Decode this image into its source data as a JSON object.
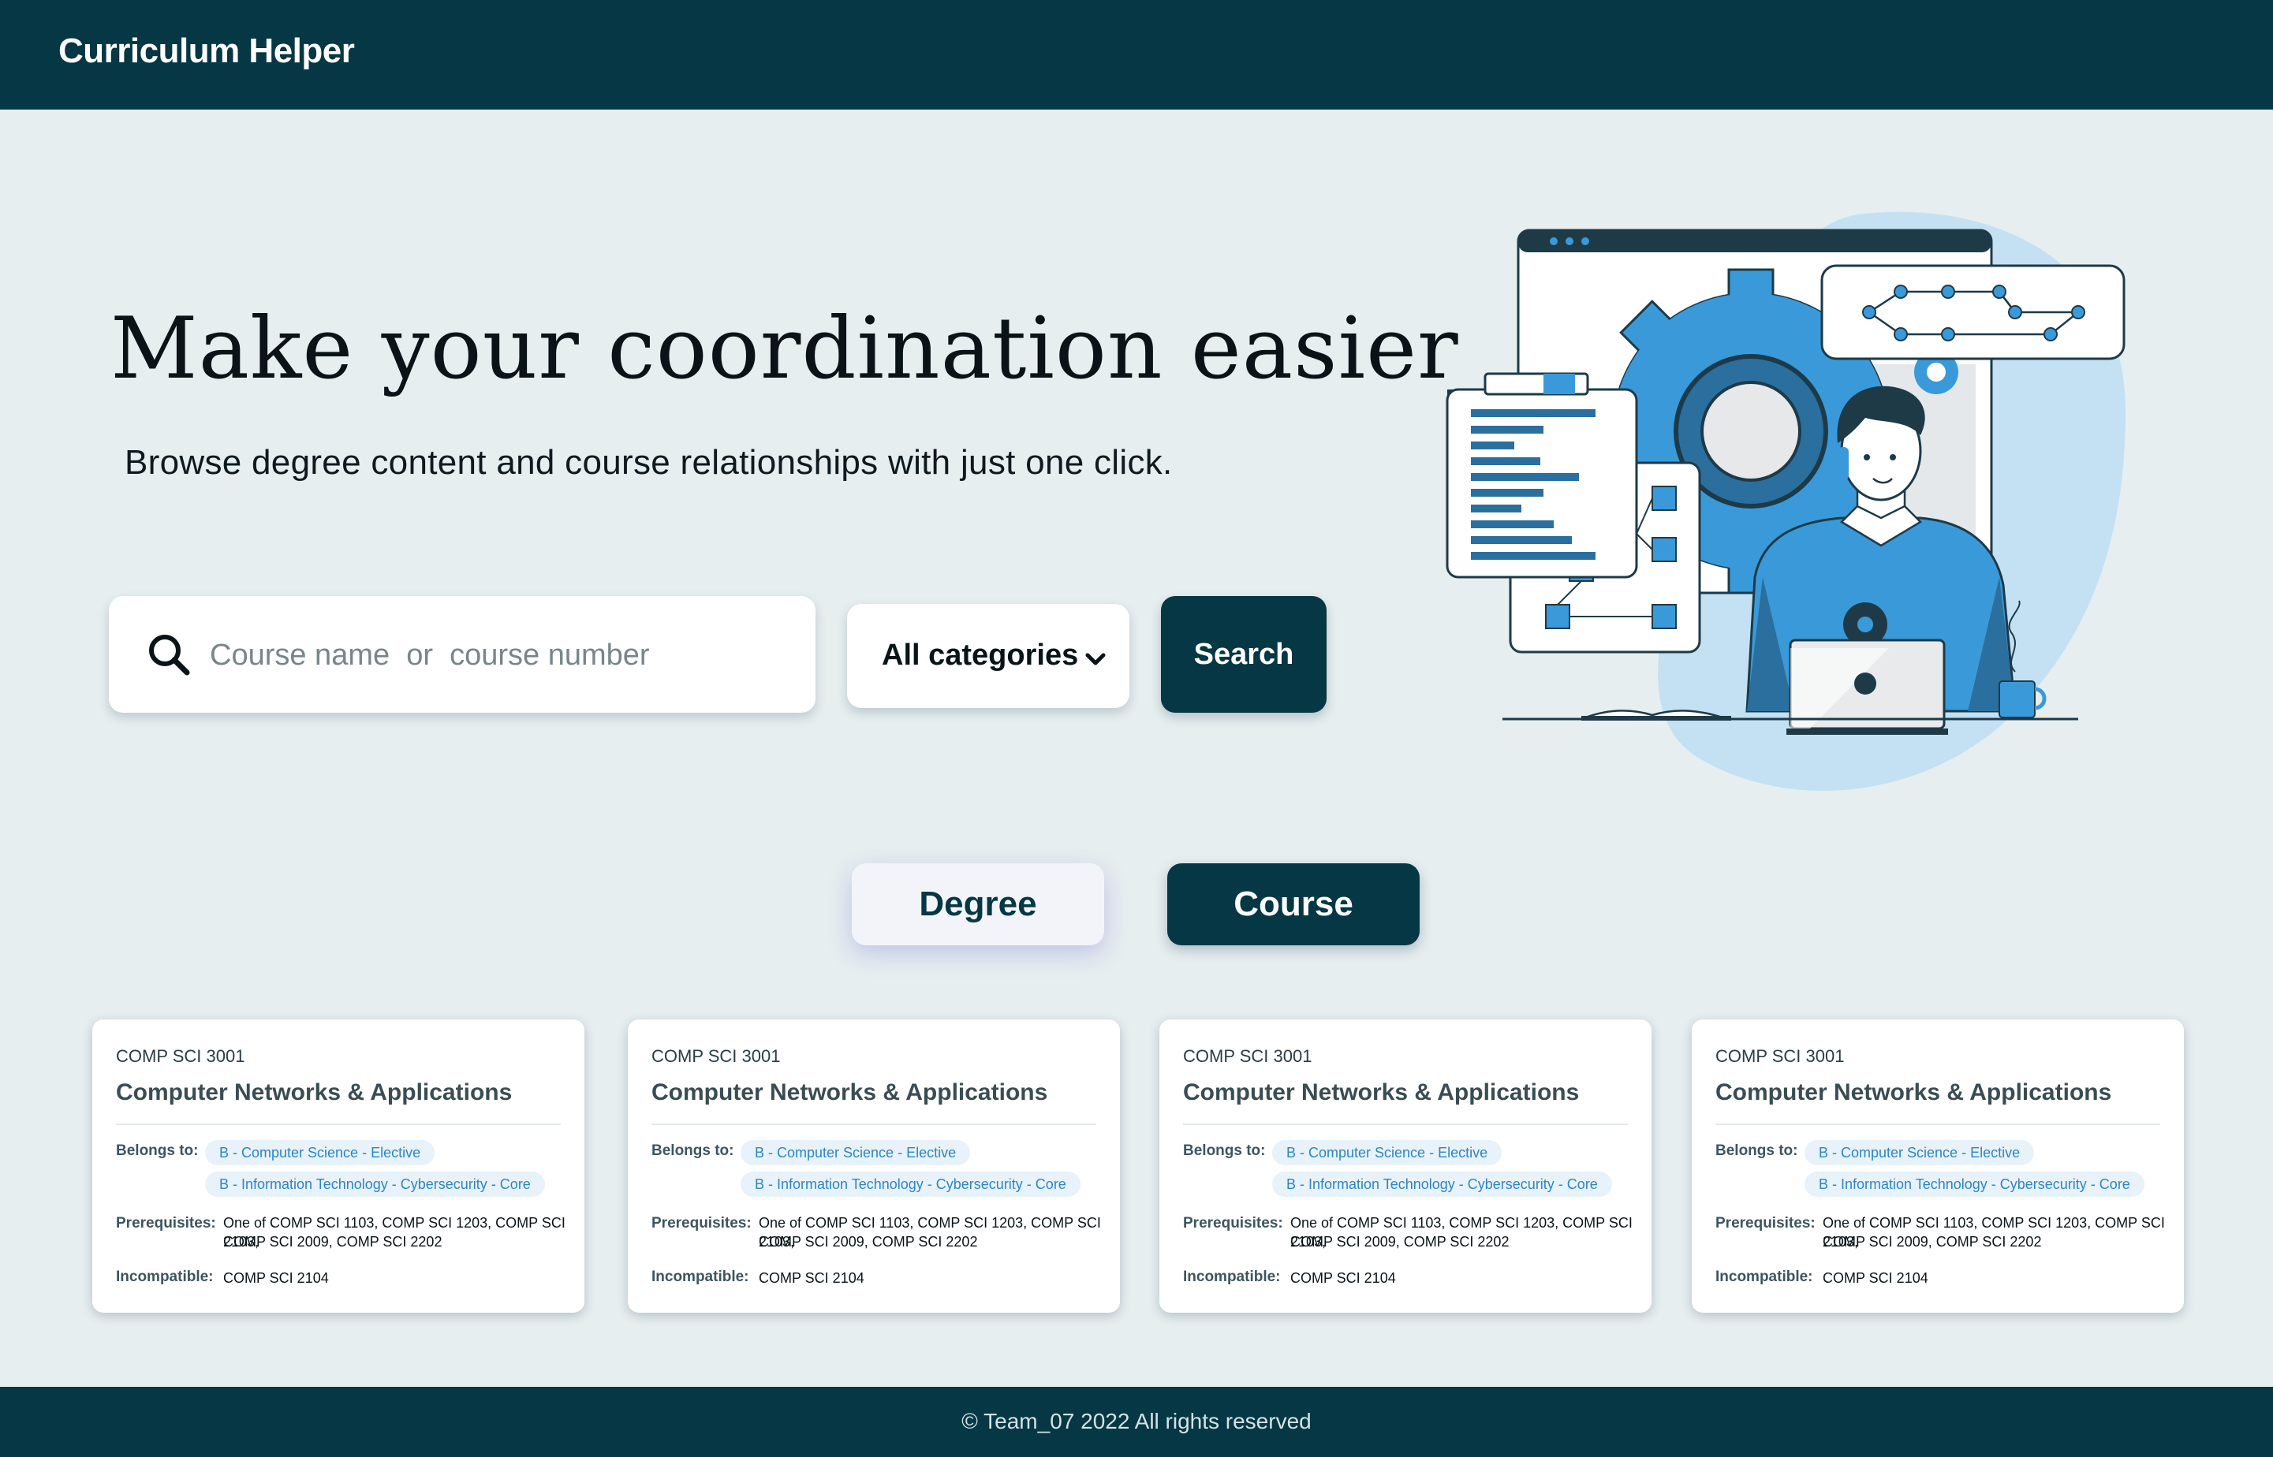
{
  "header": {
    "brand": "Curriculum Helper"
  },
  "hero": {
    "title": "Make your coordination easier",
    "subtitle": "Browse degree content and course relationships with just one click."
  },
  "search": {
    "placeholder": "Course name  or  course number",
    "category_selected": "All categories",
    "button_label": "Search"
  },
  "toggle": {
    "degree_label": "Degree",
    "course_label": "Course",
    "active": "Course"
  },
  "labels": {
    "belongs_to": "Belongs to:",
    "prerequisites": "Prerequisites:",
    "incompatible": "Incompatible:"
  },
  "cards": [
    {
      "code": "COMP SCI 3001",
      "title": "Computer Networks & Applications",
      "belongs_to": [
        "B - Computer Science - Elective",
        "B - Information Technology - Cybersecurity - Core"
      ],
      "prerequisites": [
        "One of COMP SCI 1103, COMP SCI 1203, COMP SCI 2103,",
        "COMP SCI 2009, COMP SCI 2202"
      ],
      "incompatible": "COMP SCI 2104"
    },
    {
      "code": "COMP SCI 3001",
      "title": "Computer Networks & Applications",
      "belongs_to": [
        "B - Computer Science - Elective",
        "B - Information Technology - Cybersecurity - Core"
      ],
      "prerequisites": [
        "One of COMP SCI 1103, COMP SCI 1203, COMP SCI 2103,",
        "COMP SCI 2009, COMP SCI 2202"
      ],
      "incompatible": "COMP SCI 2104"
    },
    {
      "code": "COMP SCI 3001",
      "title": "Computer Networks & Applications",
      "belongs_to": [
        "B - Computer Science - Elective",
        "B - Information Technology - Cybersecurity - Core"
      ],
      "prerequisites": [
        "One of COMP SCI 1103, COMP SCI 1203, COMP SCI 2103,",
        "COMP SCI 2009, COMP SCI 2202"
      ],
      "incompatible": "COMP SCI 2104"
    },
    {
      "code": "COMP SCI 3001",
      "title": "Computer Networks & Applications",
      "belongs_to": [
        "B - Computer Science - Elective",
        "B - Information Technology - Cybersecurity - Core"
      ],
      "prerequisites": [
        "One of COMP SCI 1103, COMP SCI 1203, COMP SCI 2103,",
        "COMP SCI 2009, COMP SCI 2202"
      ],
      "incompatible": "COMP SCI 2104"
    }
  ],
  "footer": {
    "text": "© Team_07   2022   All rights reserved"
  },
  "colors": {
    "primary": "#053744",
    "background": "#e6eef0",
    "accent_blue": "#3a9ad9",
    "tag_text": "#2c86c4"
  },
  "icons": {
    "search": "search-icon",
    "dropdown": "chevron-down-icon"
  }
}
